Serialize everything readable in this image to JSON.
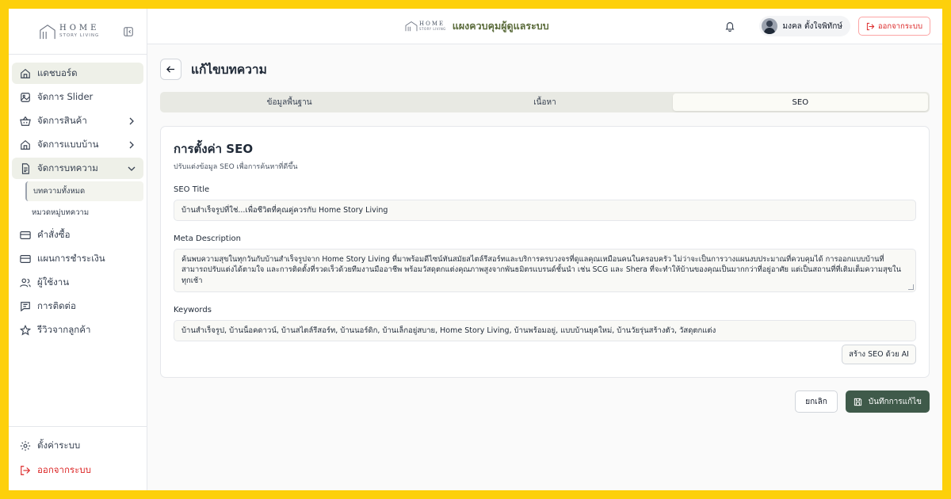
{
  "brand": {
    "line1": "HOME",
    "line2": "STORY LIVING"
  },
  "sidebar": {
    "items": [
      {
        "label": "แดชบอร์ด",
        "icon": "home-icon"
      },
      {
        "label": "จัดการ Slider",
        "icon": "image-icon"
      },
      {
        "label": "จัดการสินค้า",
        "icon": "basket-icon"
      },
      {
        "label": "จัดการแบบบ้าน",
        "icon": "house-icon"
      },
      {
        "label": "จัดการบทความ",
        "icon": "document-icon"
      }
    ],
    "sub_items": [
      {
        "label": "บทความทั้งหมด"
      },
      {
        "label": "หมวดหมู่บทความ"
      }
    ],
    "items2": [
      {
        "label": "คำสั่งซื้อ",
        "icon": "card-icon"
      },
      {
        "label": "แผนการชำระเงิน",
        "icon": "card-icon"
      },
      {
        "label": "ผู้ใช้งาน",
        "icon": "users-icon"
      },
      {
        "label": "การติดต่อ",
        "icon": "message-icon"
      },
      {
        "label": "รีวิวจากลูกค้า",
        "icon": "star-icon"
      }
    ],
    "settings_label": "ตั้งค่าระบบ",
    "logout_label": "ออกจากระบบ"
  },
  "topbar": {
    "title": "แผงควบคุมผู้ดูแลระบบ",
    "user_name": "มงคล ตั้งใจพิทักษ์",
    "logout_label": "ออกจากระบบ"
  },
  "page": {
    "title": "แก้ไขบทความ",
    "tabs": [
      "ข้อมูลพื้นฐาน",
      "เนื้อหา",
      "SEO"
    ]
  },
  "seo": {
    "title": "การตั้งค่า SEO",
    "subtitle": "ปรับแต่งข้อมูล SEO เพื่อการค้นหาที่ดีขึ้น",
    "seo_title_label": "SEO Title",
    "seo_title_value": "บ้านสำเร็จรูปที่ใช่...เพื่อชีวิตที่คุณคู่ควรกับ Home Story Living",
    "meta_label": "Meta Description",
    "meta_value": "ค้นพบความสุขในทุกวันกับบ้านสำเร็จรูปจาก Home Story Living ที่มาพร้อมดีไซน์ทันสมัยสไตล์รีสอร์ทและบริการครบวงจรที่ดูแลคุณเหมือนคนในครอบครัว ไม่ว่าจะเป็นการวางแผนงบประมาณที่ควบคุมได้ การออกแบบบ้านที่สามารถปรับแต่งได้ตามใจ และการติดตั้งที่รวดเร็วด้วยทีมงานมืออาชีพ พร้อมวัสดุตกแต่งคุณภาพสูงจากพันธมิตรแบรนด์ชั้นนำ เช่น SCG และ Shera ที่จะทำให้บ้านของคุณเป็นมากกว่าที่อยู่อาศัย แต่เป็นสถานที่ที่เติมเต็มความสุขในทุกเช้า",
    "keywords_label": "Keywords",
    "keywords_value": "บ้านสำเร็จรูป, บ้านน็อคดาวน์, บ้านสไตล์รีสอร์ท, บ้านนอร์ดิก, บ้านเล็กอยู่สบาย, Home Story Living, บ้านพร้อมอยู่, แบบบ้านยุคใหม่, บ้านวัยรุ่นสร้างตัว, วัสดุตกแต่ง",
    "ai_button": "สร้าง SEO ด้วย AI"
  },
  "actions": {
    "cancel": "ยกเลิก",
    "save": "บันทึกการแก้ไข"
  }
}
